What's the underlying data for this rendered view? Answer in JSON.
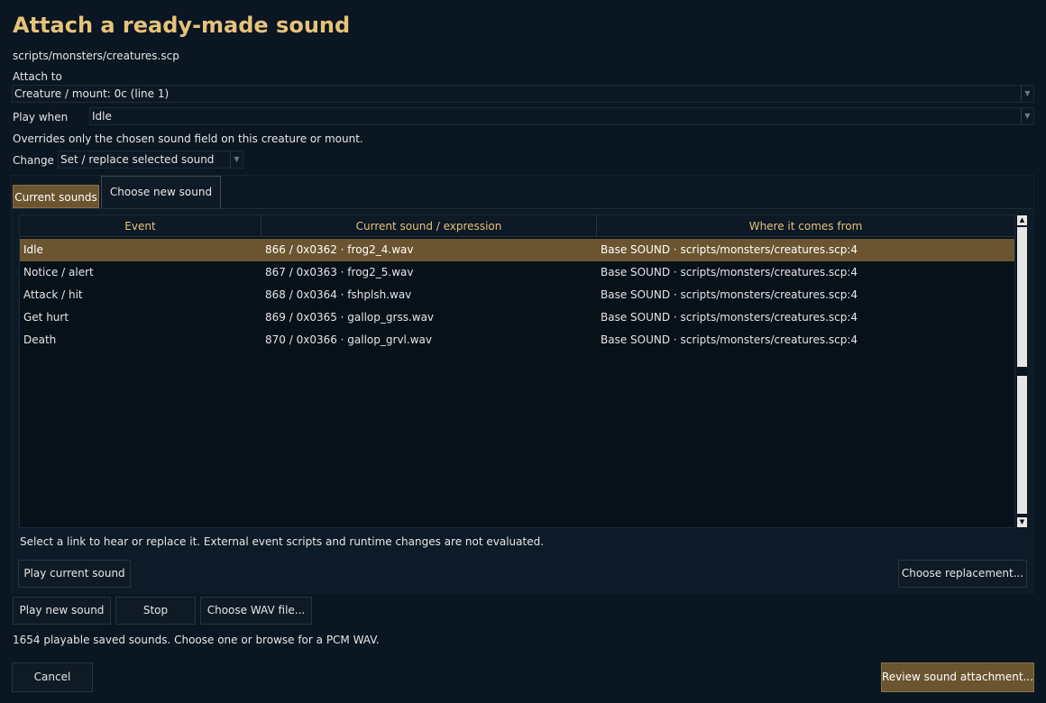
{
  "title": "Attach a ready-made sound",
  "file_path": "scripts/monsters/creatures.scp",
  "attach_to": {
    "label": "Attach to",
    "value": "Creature / mount: 0c (line 1)"
  },
  "play_when": {
    "label": "Play when",
    "value": "Idle"
  },
  "note": "Overrides only the chosen sound field on this creature or mount.",
  "change": {
    "label": "Change",
    "value": "Set / replace selected sound"
  },
  "tabs": {
    "current": "Current sounds",
    "new": "Choose new sound"
  },
  "table": {
    "headers": [
      "Event",
      "Current sound / expression",
      "Where it comes from"
    ],
    "rows": [
      {
        "event": "Idle",
        "sound": "866 / 0x0362 · frog2_4.wav",
        "source": "Base SOUND · scripts/monsters/creatures.scp:4"
      },
      {
        "event": "Notice / alert",
        "sound": "867 / 0x0363 · frog2_5.wav",
        "source": "Base SOUND · scripts/monsters/creatures.scp:4"
      },
      {
        "event": "Attack / hit",
        "sound": "868 / 0x0364 · fshplsh.wav",
        "source": "Base SOUND · scripts/monsters/creatures.scp:4"
      },
      {
        "event": "Get hurt",
        "sound": "869 / 0x0365 · gallop_grss.wav",
        "source": "Base SOUND · scripts/monsters/creatures.scp:4"
      },
      {
        "event": "Death",
        "sound": "870 / 0x0366 · gallop_grvl.wav",
        "source": "Base SOUND · scripts/monsters/creatures.scp:4"
      }
    ]
  },
  "hint": "Select a link to hear or replace it. External event scripts and runtime changes are not evaluated.",
  "buttons": {
    "play_current": "Play current sound",
    "choose_replacement": "Choose replacement...",
    "play_new": "Play new sound",
    "stop": "Stop",
    "choose_wav": "Choose WAV file...",
    "cancel": "Cancel",
    "review": "Review sound attachment..."
  },
  "status": "1654 playable saved sounds. Choose one or browse for a PCM WAV.",
  "colors": {
    "accent": "#e6c27a",
    "selection": "#6a5530",
    "background": "#0a1622"
  }
}
